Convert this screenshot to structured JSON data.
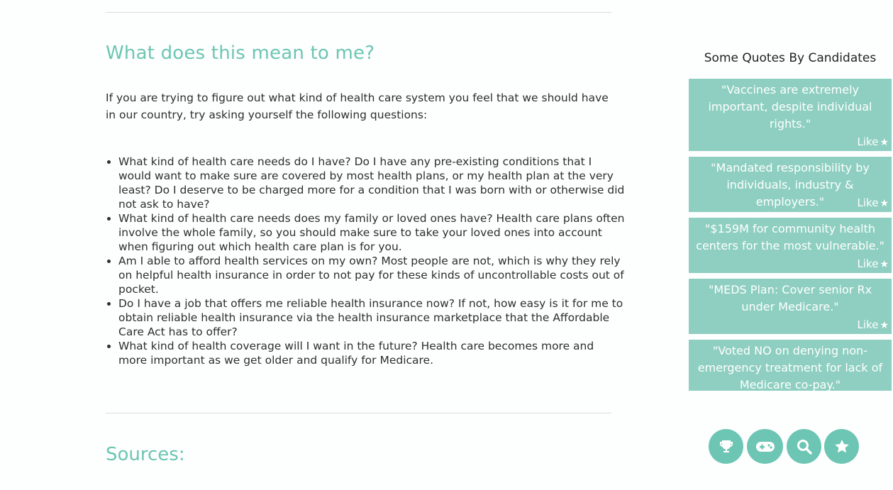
{
  "main": {
    "heading": "What does this mean to me?",
    "intro": "If you are trying to figure out what kind of health care system you feel that we should have in our country, try asking yourself the following questions:",
    "questions": [
      "What kind of health care needs do I have?  Do I have any pre-existing conditions that I would want to make sure are covered by most health plans, or my health plan at the very least? Do I deserve to be charged more for a condition that I was born with or otherwise did not ask to have?",
      "What kind of health care needs does my family or loved ones have?  Health care plans often involve the whole family, so you should make sure to take your loved ones into account when figuring out which health care plan is for you.",
      "Am I able to afford health services on my own?  Most people are not, which is why they rely on helpful health insurance in order to not pay for these kinds of uncontrollable costs out of pocket.",
      "Do I have a job that offers me reliable health insurance now?  If not, how easy is it for me to obtain reliable health insurance via the health insurance marketplace that the Affordable Care Act has to offer?",
      "What kind of health coverage will I want in the future?  Health care becomes more and more important as we get older and qualify for Medicare."
    ],
    "sources_heading": "Sources:"
  },
  "sidebar": {
    "title": "Some Quotes By Candidates",
    "like_label": "Like",
    "quotes": [
      {
        "text": "\"Vaccines are extremely important, despite individual rights.\""
      },
      {
        "text": "\"Mandated responsibility by individuals, industry & employers.\""
      },
      {
        "text": "\"$159M for community health centers for the most vulnerable.\""
      },
      {
        "text": "\"MEDS Plan: Cover senior Rx under Medicare.\""
      },
      {
        "text": "\"Voted NO on denying non-emergency treatment for lack of Medicare co-pay.\""
      }
    ],
    "nav_icons": [
      "trophy-icon",
      "gamepad-icon",
      "search-icon",
      "star-icon"
    ]
  },
  "colors": {
    "accent": "#6cc6b3",
    "card": "#8ecfc1",
    "text": "#2e2e2e"
  }
}
